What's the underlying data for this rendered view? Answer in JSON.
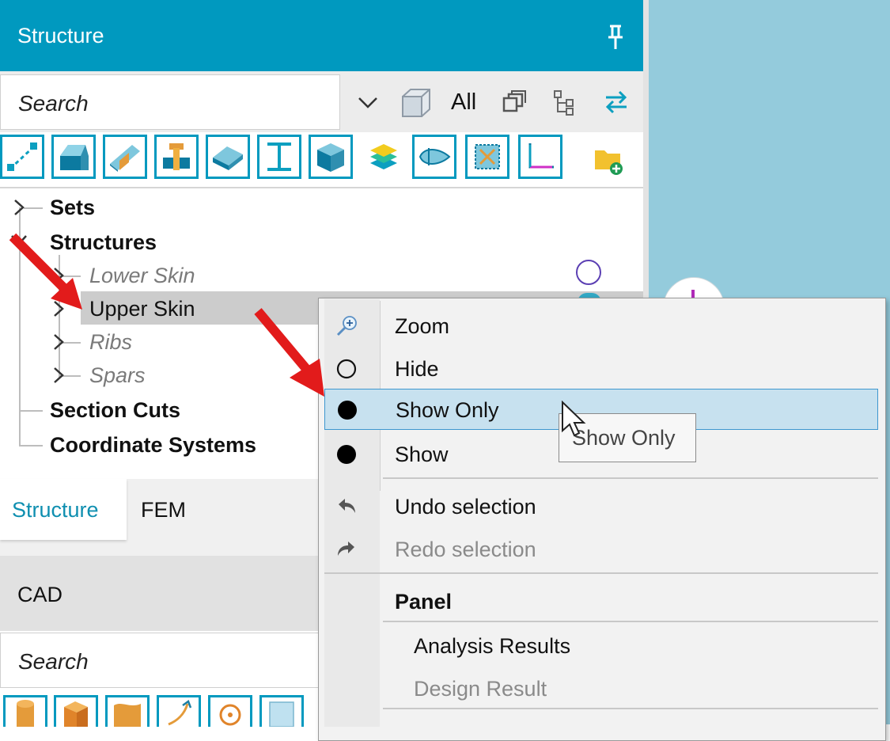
{
  "header": {
    "title": "Structure"
  },
  "search": {
    "placeholder": "Search",
    "filter_label": "All"
  },
  "tree": {
    "items": [
      {
        "label": "Sets"
      },
      {
        "label": "Structures"
      },
      {
        "label": "Lower Skin"
      },
      {
        "label": "Upper Skin"
      },
      {
        "label": "Ribs"
      },
      {
        "label": "Spars"
      },
      {
        "label": "Section Cuts"
      },
      {
        "label": "Coordinate Systems"
      }
    ]
  },
  "tabs": {
    "structure": "Structure",
    "fem": "FEM"
  },
  "cad": {
    "label": "CAD",
    "search_placeholder": "Search"
  },
  "context_menu": {
    "items": [
      {
        "label": "Zoom"
      },
      {
        "label": "Hide"
      },
      {
        "label": "Show Only"
      },
      {
        "label": "Show"
      },
      {
        "label": "Undo selection"
      },
      {
        "label": "Redo selection"
      }
    ],
    "panel_header": "Panel",
    "panel_items": [
      {
        "label": "Analysis Results"
      },
      {
        "label": "Design Result"
      }
    ]
  },
  "tooltip": {
    "text": "Show Only"
  },
  "colors": {
    "accent": "#0099bf",
    "viewport": "#94cbdc",
    "selection": "#c7e1ef",
    "arrow": "#e21b1b"
  }
}
